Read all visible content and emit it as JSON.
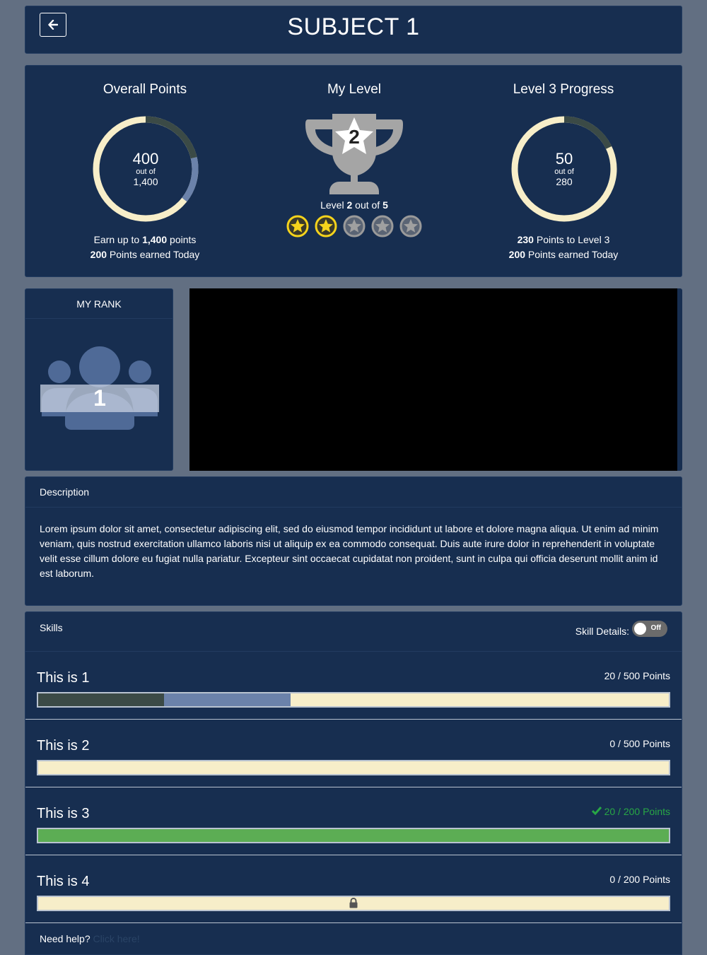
{
  "header": {
    "title": "SUBJECT 1"
  },
  "stats": {
    "overall": {
      "title": "Overall Points",
      "value": "400",
      "out_of_label": "out of",
      "total": "1,400",
      "earn_prefix": "Earn up to ",
      "earn_value": "1,400",
      "earn_suffix": " points",
      "today_value": "200",
      "today_suffix": " Points earned Today",
      "ring_fraction_earned_before": 0.214,
      "ring_fraction_today": 0.143
    },
    "level": {
      "title": "My Level",
      "trophy_number": "2",
      "level_prefix": "Level ",
      "level_current": "2",
      "level_mid": " out of ",
      "level_max": "5",
      "stars_earned": 2,
      "stars_total": 5
    },
    "progress": {
      "title": "Level 3 Progress",
      "value": "50",
      "out_of_label": "out of",
      "total": "280",
      "to_level_value": "230",
      "to_level_suffix": " Points to Level 3",
      "today_value": "200",
      "today_suffix": " Points earned Today",
      "ring_fraction": 0.179
    }
  },
  "rank": {
    "title": "MY RANK",
    "value": "1"
  },
  "description": {
    "title": "Description",
    "body": "Lorem ipsum dolor sit amet, consectetur adipiscing elit, sed do eiusmod tempor incididunt ut labore et dolore magna aliqua. Ut enim ad minim veniam, quis nostrud exercitation ullamco laboris nisi ut aliquip ex ea commodo consequat. Duis aute irure dolor in reprehenderit in voluptate velit esse cillum dolore eu fugiat nulla pariatur. Excepteur sint occaecat cupidatat non proident, sunt in culpa qui officia deserunt mollit anim id est laborum."
  },
  "skills": {
    "title": "Skills",
    "details_label": "Skill Details:",
    "toggle_label": "Off",
    "items": [
      {
        "name": "This is 1",
        "points": "20 / 500 Points",
        "fill_previous": 0.2,
        "fill_today": 0.2,
        "completed": false,
        "locked": false
      },
      {
        "name": "This is 2",
        "points": "0 / 500 Points",
        "fill_previous": 0,
        "fill_today": 0,
        "completed": false,
        "locked": false
      },
      {
        "name": "This is 3",
        "points": "20 / 200 Points",
        "fill_previous": 1,
        "fill_today": 0,
        "completed": true,
        "locked": false
      },
      {
        "name": "This is 4",
        "points": "0 / 200 Points",
        "fill_previous": 0,
        "fill_today": 0,
        "completed": false,
        "locked": true
      }
    ]
  },
  "help": {
    "prefix": "Need help? ",
    "link": "Click here!"
  },
  "colors": {
    "panel": "#172e50",
    "ring_track": "#f7eec9",
    "ring_previous": "#3b4a46",
    "ring_today": "#6b82aa",
    "bar_previous": "#3b4a46",
    "bar_today": "#6b82aa",
    "bar_complete": "#5cad54",
    "star_gold": "#f5d31c",
    "trophy_gray": "#a5a5a5"
  }
}
